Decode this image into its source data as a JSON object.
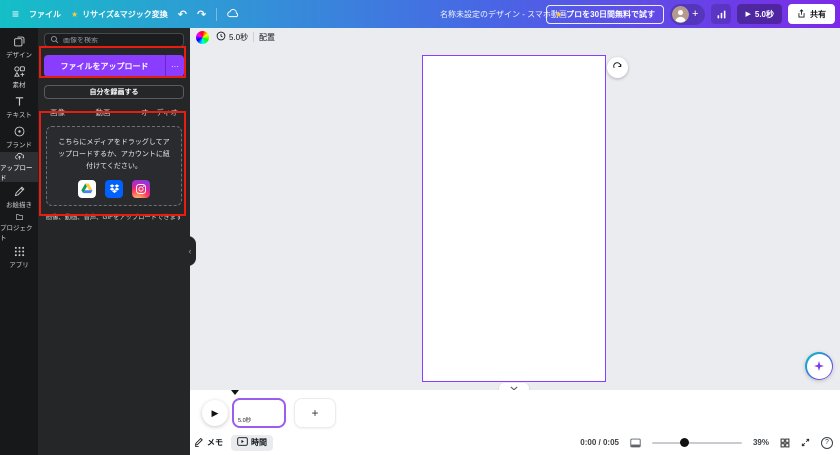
{
  "topbar": {
    "file_menu": "ファイル",
    "resize_magic": "リサイズ&マジック変換",
    "doc_title": "名称未設定のデザイン - スマホ動画",
    "pro_trial_button": "プロを30日間無料で試す",
    "play_button": "5.0秒",
    "share_button": "共有"
  },
  "rail": {
    "items": [
      {
        "label": "デザイン"
      },
      {
        "label": "素材"
      },
      {
        "label": "テキスト"
      },
      {
        "label": "ブランド"
      },
      {
        "label": "アップロード"
      },
      {
        "label": "お絵描き"
      },
      {
        "label": "プロジェクト"
      },
      {
        "label": "アプリ"
      }
    ]
  },
  "panel": {
    "search_placeholder": "画像を検索",
    "upload_button": "ファイルをアップロード",
    "more_button": "···",
    "record_button": "自分を録画する",
    "tabs": [
      "画像",
      "動画",
      "オーディオ"
    ],
    "dropzone": {
      "text": "こちらにメディアをドラッグしてアップロードするか、アカウントに紐付けてください。",
      "services": [
        "google-drive",
        "dropbox",
        "instagram"
      ],
      "caption": "画像、動画、音声、GIFをアップロードできます"
    }
  },
  "canvas": {
    "duration_chip": "5.0秒",
    "position_button": "配置"
  },
  "timeline": {
    "frame_duration": "5.0秒",
    "add_button": "+"
  },
  "bottombar": {
    "notes_button": "メモ",
    "timing_button": "時間",
    "time_display": "0:00 / 0:05",
    "zoom_level": "39%",
    "help": "?"
  },
  "colors": {
    "accent_purple": "#8b3dff",
    "annotation_red": "#e71d12",
    "topbar_teal": "#14bfc7",
    "topbar_purple": "#7d2ae8",
    "dropbox_blue": "#0061fe",
    "canvas_bg": "#ebecf0"
  }
}
